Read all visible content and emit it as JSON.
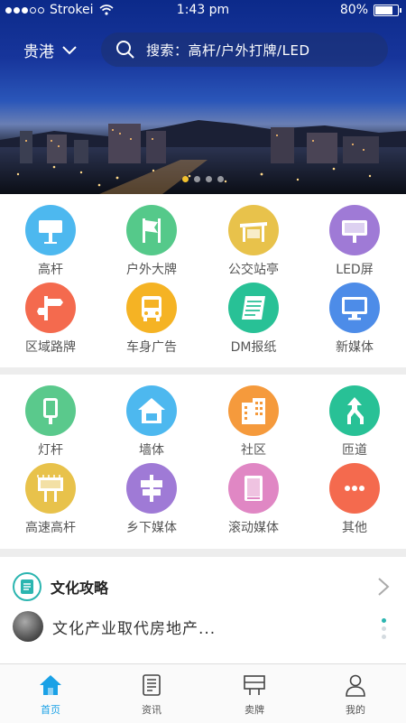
{
  "status_bar": {
    "carrier": "Strokei",
    "time": "1:43 pm",
    "battery": "80%"
  },
  "header": {
    "city": "贵港",
    "search_placeholder": "搜索：高杆/户外打牌/LED"
  },
  "banner": {
    "page_count": 4,
    "active_page": 0
  },
  "colors": {
    "accent": "#1aa1e6",
    "teal": "#2bb5b0"
  },
  "categories_1": [
    {
      "label": "高杆",
      "icon": "billboard-icon",
      "color": "#4db8ef"
    },
    {
      "label": "户外大牌",
      "icon": "flag-board-icon",
      "color": "#55c98a"
    },
    {
      "label": "公交站亭",
      "icon": "bus-shelter-icon",
      "color": "#e8c24b"
    },
    {
      "label": "LED屏",
      "icon": "led-screen-icon",
      "color": "#9f7ad6"
    },
    {
      "label": "区域路牌",
      "icon": "road-sign-icon",
      "color": "#f46a4e"
    },
    {
      "label": "车身广告",
      "icon": "bus-icon",
      "color": "#f5b324"
    },
    {
      "label": "DM报纸",
      "icon": "newspaper-icon",
      "color": "#28c196"
    },
    {
      "label": "新媒体",
      "icon": "monitor-icon",
      "color": "#4d8ce8"
    }
  ],
  "categories_2": [
    {
      "label": "灯杆",
      "icon": "lamp-post-icon",
      "color": "#5ac98c"
    },
    {
      "label": "墙体",
      "icon": "house-wall-icon",
      "color": "#4db8ef"
    },
    {
      "label": "社区",
      "icon": "building-icon",
      "color": "#f59a3c"
    },
    {
      "label": "匝道",
      "icon": "ramp-arrow-icon",
      "color": "#28c196"
    },
    {
      "label": "高速高杆",
      "icon": "highway-billboard-icon",
      "color": "#e8c24b"
    },
    {
      "label": "乡下媒体",
      "icon": "village-sign-icon",
      "color": "#9f7ad6"
    },
    {
      "label": "滚动媒体",
      "icon": "scroll-board-icon",
      "color": "#e087c4"
    },
    {
      "label": "其他",
      "icon": "more-icon",
      "color": "#f46a4e"
    }
  ],
  "culture": {
    "title": "文化攻略",
    "headline": "文化产业取代房地产..."
  },
  "tabs": [
    {
      "label": "首页",
      "icon": "home-icon"
    },
    {
      "label": "资讯",
      "icon": "news-icon"
    },
    {
      "label": "卖牌",
      "icon": "sell-board-icon"
    },
    {
      "label": "我的",
      "icon": "profile-icon"
    }
  ],
  "active_tab": 0
}
